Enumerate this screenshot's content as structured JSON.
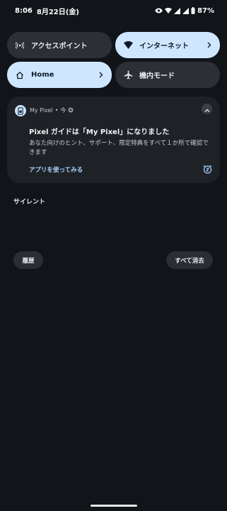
{
  "status_bar": {
    "time": "8:06",
    "date": "8月22日(金)",
    "battery_percent": "87%",
    "icons": [
      "eye-icon",
      "wifi-icon",
      "signal-icon",
      "battery-icon"
    ]
  },
  "quick_settings": {
    "tiles": [
      {
        "label": "アクセスポイント",
        "icon": "hotspot-icon",
        "active": false,
        "chevron": false
      },
      {
        "label": "インターネット",
        "icon": "wifi-icon",
        "active": true,
        "chevron": true
      },
      {
        "label": "Home",
        "icon": "home-icon",
        "active": true,
        "chevron": true
      },
      {
        "label": "機内モード",
        "icon": "airplane-icon",
        "active": false,
        "chevron": false
      }
    ]
  },
  "notification": {
    "app_name": "My Pixel",
    "separator": "•",
    "time": "今",
    "title": "Pixel ガイドは「My Pixel」になりました",
    "body": "あなた向けのヒント、サポート、限定特典をすべて１か所で確認できます",
    "action": "アプリを使ってみる"
  },
  "section": {
    "label": "サイレント"
  },
  "footer": {
    "history_label": "履歴",
    "clear_all_label": "すべて消去"
  },
  "colors": {
    "background": "#111418",
    "tile_active": "#cfe6ff",
    "tile_inactive": "#2c2f35",
    "card": "#1e2227",
    "accent_text": "#a9d2ff"
  }
}
